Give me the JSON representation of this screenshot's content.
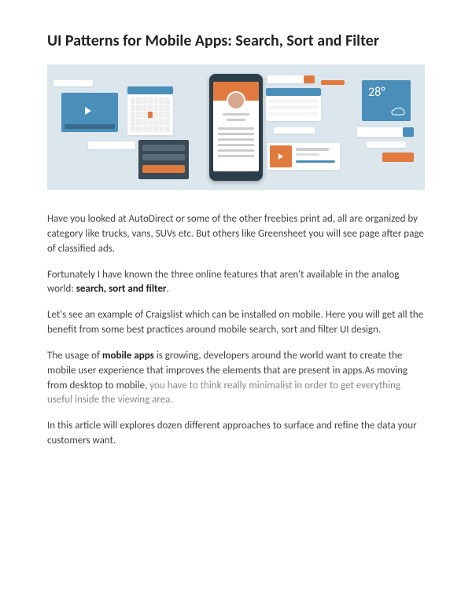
{
  "title": "UI Patterns for Mobile Apps: Search, Sort and Filter",
  "hero": {
    "weather_value": "28°"
  },
  "paragraphs": {
    "p1": "Have you looked at AutoDirect or some of the other freebies print ad, all are organized by category like trucks, vans, SUVs etc. But others like Greensheet you will see page after page of classified ads.",
    "p2a": "Fortunately I have known the three online features that aren't available in the analog world: ",
    "p2b": "search, sort and filter",
    "p2c": ".",
    "p3": "Let's see an example of Craigslist which can be installed on mobile. Here you will get all the benefit from some best practices around mobile search, sort and filter UI design.",
    "p4a": "The usage of ",
    "p4b": "mobile apps",
    "p4c": " is growing, developers around the world want to create the mobile user experience that improves the elements that are present in apps.As moving from desktop to mobile, ",
    "p4d": "you have to think really minimalist in order to get everything useful inside the viewing area.",
    "p5": "In this article will explores dozen different approaches to surface and refine the data your customers want."
  }
}
